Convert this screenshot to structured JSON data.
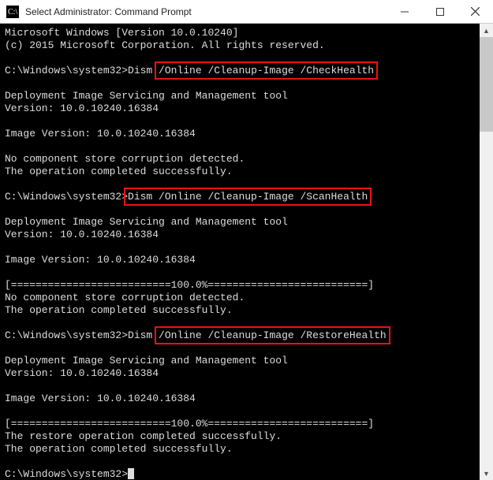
{
  "window": {
    "title": "Select Administrator: Command Prompt"
  },
  "terminal": {
    "lines": [
      {
        "segs": [
          {
            "t": "Microsoft Windows [Version 10.0.10240]"
          }
        ]
      },
      {
        "segs": [
          {
            "t": "(c) 2015 Microsoft Corporation. All rights reserved."
          }
        ]
      },
      {
        "segs": [
          {
            "t": ""
          }
        ]
      },
      {
        "segs": [
          {
            "t": "C:\\Windows\\system32>Dism "
          },
          {
            "t": "/Online /Cleanup-Image /CheckHealth",
            "hl": true
          }
        ]
      },
      {
        "segs": [
          {
            "t": ""
          }
        ]
      },
      {
        "segs": [
          {
            "t": "Deployment Image Servicing and Management tool"
          }
        ]
      },
      {
        "segs": [
          {
            "t": "Version: 10.0.10240.16384"
          }
        ]
      },
      {
        "segs": [
          {
            "t": ""
          }
        ]
      },
      {
        "segs": [
          {
            "t": "Image Version: 10.0.10240.16384"
          }
        ]
      },
      {
        "segs": [
          {
            "t": ""
          }
        ]
      },
      {
        "segs": [
          {
            "t": "No component store corruption detected."
          }
        ]
      },
      {
        "segs": [
          {
            "t": "The operation completed successfully."
          }
        ]
      },
      {
        "segs": [
          {
            "t": ""
          }
        ]
      },
      {
        "segs": [
          {
            "t": "C:\\Windows\\system32>"
          },
          {
            "t": "Dism /Online /Cleanup-Image /ScanHealth",
            "hl": true
          }
        ]
      },
      {
        "segs": [
          {
            "t": ""
          }
        ]
      },
      {
        "segs": [
          {
            "t": "Deployment Image Servicing and Management tool"
          }
        ]
      },
      {
        "segs": [
          {
            "t": "Version: 10.0.10240.16384"
          }
        ]
      },
      {
        "segs": [
          {
            "t": ""
          }
        ]
      },
      {
        "segs": [
          {
            "t": "Image Version: 10.0.10240.16384"
          }
        ]
      },
      {
        "segs": [
          {
            "t": ""
          }
        ]
      },
      {
        "segs": [
          {
            "t": "[==========================100.0%==========================]"
          }
        ]
      },
      {
        "segs": [
          {
            "t": "No component store corruption detected."
          }
        ]
      },
      {
        "segs": [
          {
            "t": "The operation completed successfully."
          }
        ]
      },
      {
        "segs": [
          {
            "t": ""
          }
        ]
      },
      {
        "segs": [
          {
            "t": "C:\\Windows\\system32>Dism "
          },
          {
            "t": "/Online /Cleanup-Image /RestoreHealth",
            "hl": true
          }
        ]
      },
      {
        "segs": [
          {
            "t": ""
          }
        ]
      },
      {
        "segs": [
          {
            "t": "Deployment Image Servicing and Management tool"
          }
        ]
      },
      {
        "segs": [
          {
            "t": "Version: 10.0.10240.16384"
          }
        ]
      },
      {
        "segs": [
          {
            "t": ""
          }
        ]
      },
      {
        "segs": [
          {
            "t": "Image Version: 10.0.10240.16384"
          }
        ]
      },
      {
        "segs": [
          {
            "t": ""
          }
        ]
      },
      {
        "segs": [
          {
            "t": "[==========================100.0%==========================]"
          }
        ]
      },
      {
        "segs": [
          {
            "t": "The restore operation completed successfully."
          }
        ]
      },
      {
        "segs": [
          {
            "t": "The operation completed successfully."
          }
        ]
      },
      {
        "segs": [
          {
            "t": ""
          }
        ]
      },
      {
        "segs": [
          {
            "t": "C:\\Windows\\system32>"
          }
        ],
        "cursor": true
      }
    ]
  }
}
